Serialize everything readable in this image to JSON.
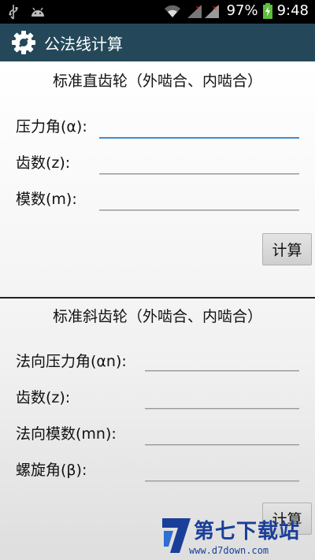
{
  "status_bar": {
    "battery": "97%",
    "time": "9:48",
    "icons": [
      "usb-icon",
      "android-icon",
      "wifi-icon",
      "signal-icon",
      "battery-charging-icon"
    ]
  },
  "app": {
    "title": "公法线计算",
    "icon": "gear-icon"
  },
  "spur": {
    "title": "标准直齿轮（外啮合、内啮合）",
    "pressure_angle_label": "压力角(α):",
    "teeth_label": "齿数(z):",
    "module_label": "模数(m):",
    "calc_label": "计算"
  },
  "helical": {
    "title": "标准斜齿轮（外啮合、内啮合）",
    "normal_pressure_angle_label": "法向压力角(αn):",
    "teeth_label": "齿数(z):",
    "normal_module_label": "法向模数(mn):",
    "helix_angle_label": "螺旋角(β):",
    "calc_label": "计算"
  },
  "watermark": {
    "brand": "第七下载站",
    "url": "www.d7down.com"
  },
  "colors": {
    "action_bar": "#24485a",
    "focus_underline": "#3a8ed6",
    "watermark": "#1a3f9a"
  }
}
